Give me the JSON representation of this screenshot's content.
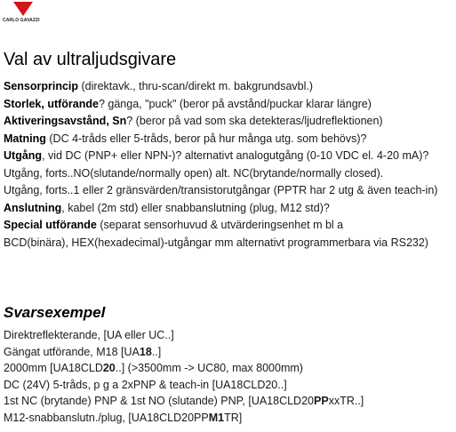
{
  "logo": {
    "text": "CARLO GAVAZZI",
    "color": "#d2141a"
  },
  "title": "Val av ultraljudsgivare",
  "lines": [
    {
      "b": "Sensorprincip",
      "t": " (direktavk., thru-scan/direkt m. bakgrundsavbl.)"
    },
    {
      "b": "Storlek, utförande",
      "t": "? gänga, \"puck\" (beror på avstånd/puckar klarar längre)"
    },
    {
      "b": "Aktiveringsavstånd, Sn",
      "t": "? (beror på vad som ska detekteras/ljudreflektionen)"
    },
    {
      "b": "Matning",
      "t": " (DC 4-tråds eller 5-tråds, beror på hur många utg. som behövs)?"
    },
    {
      "b": "Utgång",
      "t": ", vid DC (PNP+ eller NPN-)? alternativt analogutgång (0-10 VDC el. 4-20 mA)?"
    },
    {
      "b": "",
      "t": "Utgång, forts..NO(slutande/normally open) alt. NC(brytande/normally closed)."
    },
    {
      "b": "",
      "t": "Utgång, forts..1 eller 2 gränsvärden/transistorutgångar (PPTR har 2 utg & även teach-in)"
    },
    {
      "b": "Anslutning",
      "t": ", kabel (2m std) eller snabbanslutning (plug, M12 std)?"
    },
    {
      "b": "Special utförande",
      "t": " (separat sensorhuvud & utvärderingsenhet m bl a"
    },
    {
      "b": "",
      "t": "BCD(binära), HEX(hexadecimal)-utgångar mm alternativt programmerbara via RS232)"
    }
  ],
  "examples_title": "Svarsexempel",
  "examples": [
    [
      {
        "t": "Direktreflekterande, [UA eller UC..]"
      }
    ],
    [
      {
        "t": "Gängat utförande, M18  [UA"
      },
      {
        "t": "18",
        "b": true
      },
      {
        "t": "..]"
      }
    ],
    [
      {
        "t": "2000mm  [UA18CLD"
      },
      {
        "t": "20",
        "b": true
      },
      {
        "t": "..] (>3500mm -> UC80, max 8000mm)"
      }
    ],
    [
      {
        "t": "DC (24V) 5-tråds, p g a 2xPNP & teach-in [UA18CLD20..]"
      }
    ],
    [
      {
        "t": "1st NC (brytande) PNP & 1st NO (slutande) PNP, [UA18CLD20"
      },
      {
        "t": "PP",
        "b": true
      },
      {
        "t": "xxTR..]"
      }
    ],
    [
      {
        "t": "M12-snabbanslutn./plug, [UA18CLD20PP"
      },
      {
        "t": "M1",
        "b": true
      },
      {
        "t": "TR]"
      }
    ]
  ]
}
